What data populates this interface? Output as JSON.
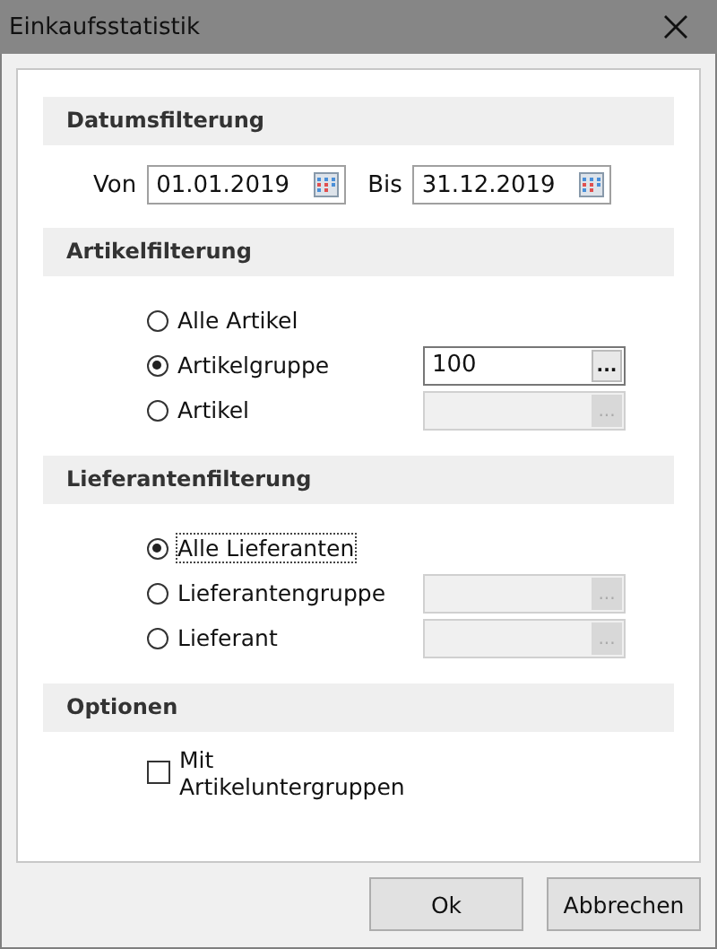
{
  "window": {
    "title": "Einkaufsstatistik"
  },
  "sections": [
    {
      "kind": "dates",
      "title": "Datumsfilterung",
      "fields": [
        {
          "label": "Von",
          "value": "01.01.2019"
        },
        {
          "label": "Bis",
          "value": "31.12.2019"
        }
      ]
    },
    {
      "kind": "radios",
      "title": "Artikelfilterung",
      "options": [
        {
          "label": "Alle Artikel",
          "selected": false,
          "focused": false
        },
        {
          "label": "Artikelgruppe",
          "selected": true,
          "focused": false,
          "picker": {
            "value": "100",
            "button": "...",
            "disabled": false
          }
        },
        {
          "label": "Artikel",
          "selected": false,
          "focused": false,
          "picker": {
            "button": "...",
            "disabled": true
          }
        }
      ]
    },
    {
      "kind": "radios",
      "title": "Lieferantenfilterung",
      "options": [
        {
          "label": "Alle Lieferanten",
          "selected": true,
          "focused": true
        },
        {
          "label": "Lieferantengruppe",
          "selected": false,
          "focused": false,
          "picker": {
            "button": "...",
            "disabled": true
          }
        },
        {
          "label": "Lieferant",
          "selected": false,
          "focused": false,
          "picker": {
            "button": "...",
            "disabled": true
          }
        }
      ]
    },
    {
      "kind": "checks",
      "title": "Optionen",
      "options": [
        {
          "label": "Mit Artikeluntergruppen",
          "checked": false
        }
      ]
    }
  ],
  "buttons": [
    "Ok",
    "Abbrechen"
  ]
}
